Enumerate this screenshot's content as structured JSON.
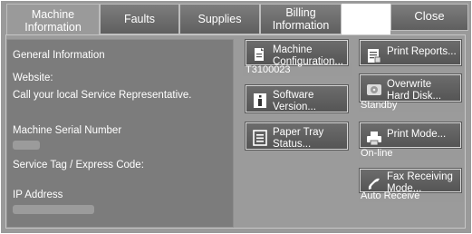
{
  "tabs": {
    "machine_information": "Machine\nInformation",
    "faults": "Faults",
    "supplies": "Supplies",
    "billing_information": "Billing\nInformation",
    "close": "Close"
  },
  "general": {
    "heading": "General Information",
    "website_label": "Website:",
    "website_value": "Call your local Service Representative.",
    "serial_label": "Machine Serial Number",
    "service_tag_label": "Service Tag / Express Code:",
    "ip_label": "IP Address"
  },
  "buttons": {
    "machine_configuration": {
      "label": "Machine\nConfiguration...",
      "status": "T3100023",
      "icon": "document-icon"
    },
    "software_version": {
      "label": "Software\nVersion...",
      "icon": "info-icon"
    },
    "paper_tray_status": {
      "label": "Paper Tray\nStatus...",
      "icon": "list-icon"
    },
    "print_reports": {
      "label": "Print Reports...",
      "icon": "report-icon"
    },
    "overwrite_hard_disk": {
      "label": "Overwrite\nHard Disk...",
      "status": "Standby",
      "icon": "hard-disk-icon"
    },
    "print_mode": {
      "label": "Print Mode...",
      "status": "On-line",
      "icon": "printer-icon"
    },
    "fax_receiving_mode": {
      "label": "Fax Receiving\nMode...",
      "status": "Auto Receive",
      "icon": "phone-icon"
    }
  },
  "colors": {
    "background": "#9a9a9a",
    "tab": "#6e6e6e",
    "button": "#606060",
    "pane": "#7c7c7c"
  }
}
